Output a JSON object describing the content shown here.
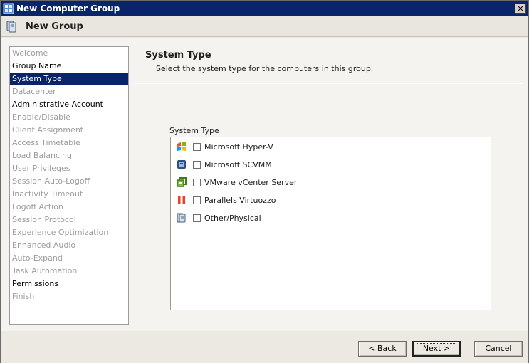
{
  "window": {
    "title": "New Computer Group"
  },
  "header": {
    "title": "New Group"
  },
  "steps": [
    {
      "label": "Welcome",
      "state": "disabled"
    },
    {
      "label": "Group Name",
      "state": "done"
    },
    {
      "label": "System Type",
      "state": "active"
    },
    {
      "label": "Datacenter",
      "state": "disabled"
    },
    {
      "label": "Administrative Account",
      "state": "done"
    },
    {
      "label": "Enable/Disable",
      "state": "disabled"
    },
    {
      "label": "Client Assignment",
      "state": "disabled"
    },
    {
      "label": "Access Timetable",
      "state": "disabled"
    },
    {
      "label": "Load Balancing",
      "state": "disabled"
    },
    {
      "label": "User Privileges",
      "state": "disabled"
    },
    {
      "label": "Session Auto-Logoff",
      "state": "disabled"
    },
    {
      "label": "Inactivity Timeout",
      "state": "disabled"
    },
    {
      "label": "Logoff Action",
      "state": "disabled"
    },
    {
      "label": "Session Protocol",
      "state": "disabled"
    },
    {
      "label": "Experience Optimization",
      "state": "disabled"
    },
    {
      "label": "Enhanced Audio",
      "state": "disabled"
    },
    {
      "label": "Auto-Expand",
      "state": "disabled"
    },
    {
      "label": "Task Automation",
      "state": "disabled"
    },
    {
      "label": "Permissions",
      "state": "done"
    },
    {
      "label": "Finish",
      "state": "disabled"
    }
  ],
  "panel": {
    "title": "System Type",
    "description": "Select the system type for the computers in this group.",
    "group_label": "System Type"
  },
  "options": [
    {
      "label": "Microsoft Hyper-V",
      "icon": "hyperv-icon",
      "checked": false
    },
    {
      "label": "Microsoft SCVMM",
      "icon": "scvmm-icon",
      "checked": false
    },
    {
      "label": "VMware vCenter Server",
      "icon": "vmware-icon",
      "checked": false
    },
    {
      "label": "Parallels Virtuozzo",
      "icon": "parallels-icon",
      "checked": false
    },
    {
      "label": "Other/Physical",
      "icon": "physical-icon",
      "checked": false
    }
  ],
  "buttons": {
    "back_prefix": "< ",
    "back_key": "B",
    "back_rest": "ack",
    "next_key": "N",
    "next_rest": "ext >",
    "cancel_key": "C",
    "cancel_rest": "ancel"
  },
  "colors": {
    "titlebar": "#0a246a",
    "selection": "#0a246a"
  }
}
